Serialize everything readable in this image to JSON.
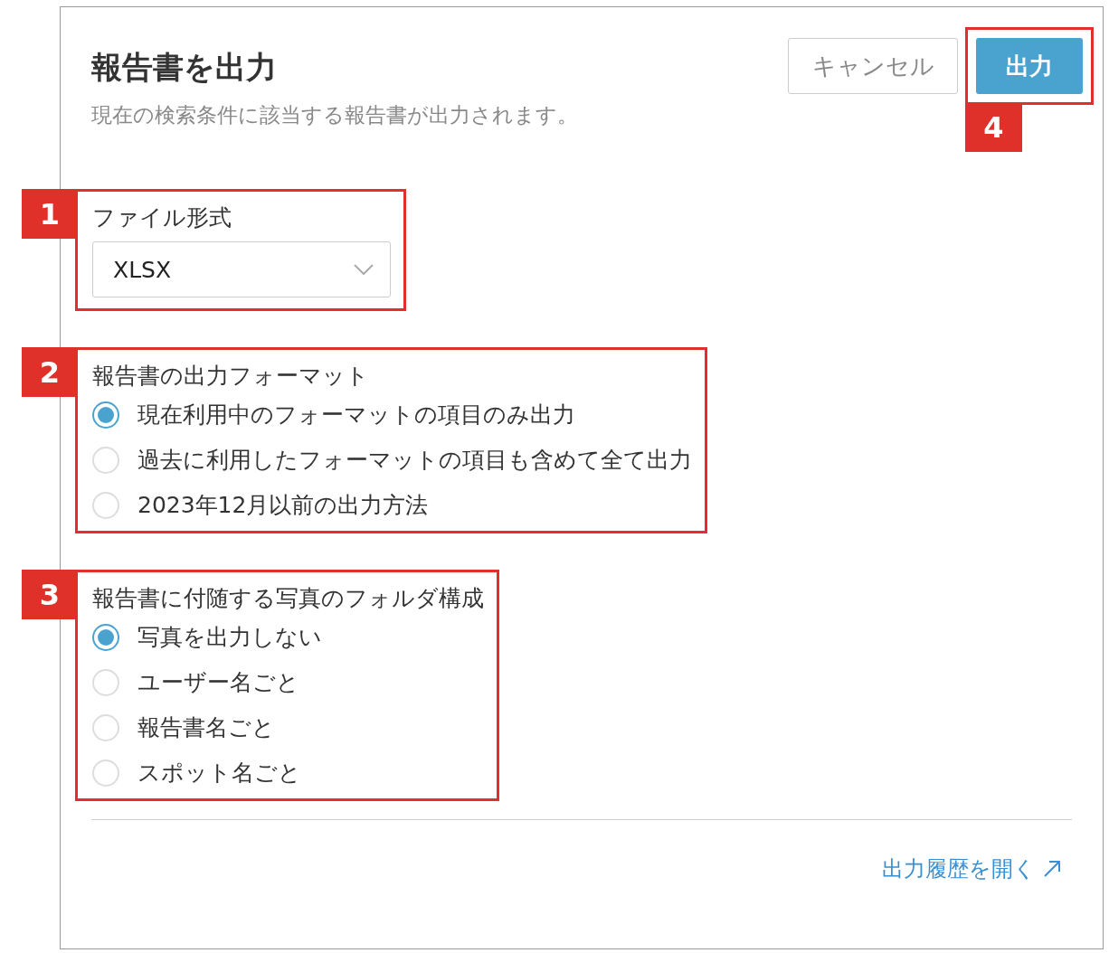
{
  "dialog": {
    "title": "報告書を出力",
    "subtitle": "現在の検索条件に該当する報告書が出力されます。",
    "buttons": [
      {
        "label": "キャンセル",
        "kind": "secondary"
      },
      {
        "label": "出力",
        "kind": "primary",
        "annotation": "4"
      }
    ],
    "sections": [
      {
        "annotation": "1",
        "label": "ファイル形式",
        "kind": "select",
        "value": "XLSX"
      },
      {
        "annotation": "2",
        "label": "報告書の出力フォーマット",
        "kind": "radio",
        "options": [
          {
            "label": "現在利用中のフォーマットの項目のみ出力",
            "selected": true
          },
          {
            "label": "過去に利用したフォーマットの項目も含めて全て出力",
            "selected": false
          },
          {
            "label": "2023年12月以前の出力方法",
            "selected": false
          }
        ]
      },
      {
        "annotation": "3",
        "label": "報告書に付随する写真のフォルダ構成",
        "kind": "radio",
        "options": [
          {
            "label": "写真を出力しない",
            "selected": true
          },
          {
            "label": "ユーザー名ごと",
            "selected": false
          },
          {
            "label": "報告書名ごと",
            "selected": false
          },
          {
            "label": "スポット名ごと",
            "selected": false
          }
        ]
      }
    ],
    "footer_link": "出力履歴を開く"
  }
}
